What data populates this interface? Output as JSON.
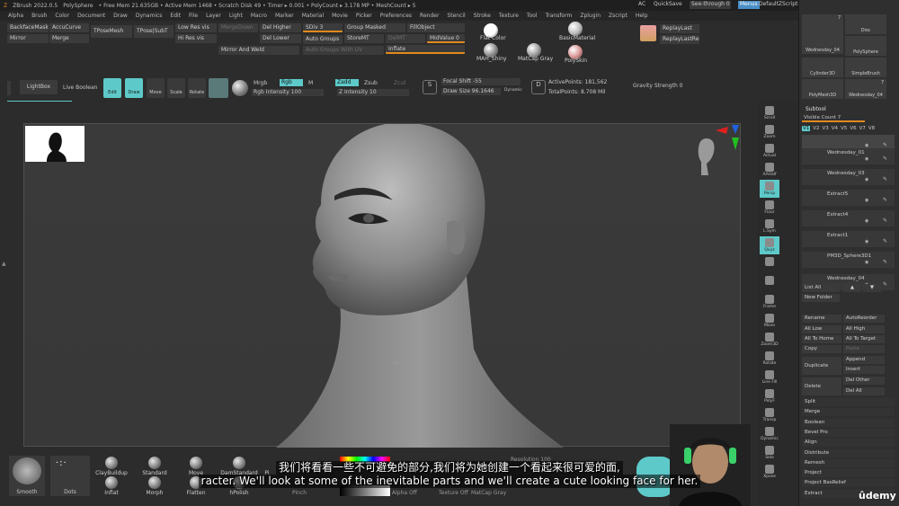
{
  "titlebar": {
    "app": "ZBrush 2022.0.5",
    "items": [
      "PolySphere",
      "• Free Mem 21.635GB • Active Mem 1468 • Scratch Disk 49 • Timer ▸ 0.001 • PolyCount ▸ 3.178 MP • MeshCount ▸ 5"
    ],
    "ac": "AC",
    "quicksave": "QuickSave",
    "see_through": "See-through 0",
    "menus": "Menus",
    "script": "DefaultZScript"
  },
  "menubar": [
    "Alpha",
    "Brush",
    "Color",
    "Document",
    "Draw",
    "Dynamics",
    "Edit",
    "File",
    "Layer",
    "Light",
    "Macro",
    "Marker",
    "Material",
    "Movie",
    "Picker",
    "Preferences",
    "Render",
    "Stencil",
    "Stroke",
    "Texture",
    "Tool",
    "Transform",
    "Zplugin",
    "Zscript",
    "Help"
  ],
  "shelf": {
    "backface_mask": "BackfaceMask",
    "accucurve": "AccuCurve",
    "mirror": "Mirror",
    "merge": "Merge",
    "tposemesh": "TPoseMesh",
    "tpose_subt": "TPose|SubT",
    "low_res": "Low Res vis",
    "hi_res": "Hi Res vis",
    "merge_down": "MergeDown",
    "mirror_and_weld": "Mirror And Weld",
    "del_higher": "Del Higher",
    "del_lower": "Del Lower",
    "sdiv": "SDiv 3",
    "group_masked": "Group Masked",
    "fill_object": "FillObject",
    "auto_groups": "Auto Groups",
    "store_mt": "StoreMT",
    "del_mt": "DelMT",
    "mid_value": "MidValue 0",
    "auto_groups_uv": "Auto Groups With UV",
    "inflate": "Inflate",
    "replay_last": "ReplayLast",
    "replay_last_rel": "ReplayLastRel"
  },
  "materials": [
    {
      "label": "Flat Color",
      "color": "#ffffff"
    },
    {
      "label": "BasicMaterial",
      "color": "#b8b8b8"
    },
    {
      "label": "MAH_Shiny",
      "color": "#8a8a8a"
    },
    {
      "label": "MatCap Gray",
      "color": "#9a9a9a"
    },
    {
      "label": "PolySkin",
      "color": "#d89090"
    }
  ],
  "toolbar": {
    "lightbox": "LightBox",
    "live_boolean": "Live Boolean",
    "edit": "Edit",
    "draw": "Draw",
    "move": "Move",
    "scale": "Scale",
    "rotate": "Rotate",
    "mrgb": "Mrgb",
    "rgb": "Rgb",
    "m": "M",
    "rgb_intensity": "Rgb Intensity 100",
    "zadd": "Zadd",
    "zsub": "Zsub",
    "zcut": "Zcut",
    "z_intensity": "Z Intensity 10",
    "focal_shift": "Focal Shift -55",
    "draw_size": "Draw Size 96.1646",
    "dynamic": "Dynamic",
    "active_points": "ActivePoints: 181,562",
    "total_points": "TotalPoints: 8.708 Mil",
    "gravity": "Gravity Strength 0"
  },
  "right_bar": [
    "Scroll",
    "Zoom",
    "Actual",
    "AAHalf",
    "Persp",
    "Floor",
    "L.Sym",
    "Qxyz",
    "",
    "",
    "Frame",
    "Move",
    "Zoom3D",
    "Rotate",
    "Line Fill",
    "PolyF",
    "Transp",
    "Dynamic",
    "Solo",
    "Xpose"
  ],
  "panel": {
    "thumbs": [
      "Wednesday_04",
      "Disc",
      "Cylinder3D",
      "PolySphere",
      "SimpleBrush",
      "PolyMesh3D",
      "Wednesday_04"
    ],
    "thumb_counts": [
      "7",
      "7"
    ],
    "subtool_title": "Subtool",
    "visible_count": "Visible Count 7",
    "versions": [
      "V1",
      "V2",
      "V3",
      "V4",
      "V5",
      "V6",
      "V7",
      "V8"
    ],
    "subtools": [
      "",
      "Wednesday_01",
      "Wednesday_03",
      "Extract5",
      "Extract4",
      "Extract1",
      "PM3D_Sphere3D1",
      "Wednesday_04"
    ],
    "list_all": "List All",
    "new_folder": "New Folder",
    "rename": "Rename",
    "auto_reorder": "AutoReorder",
    "all_low": "All Low",
    "all_high": "All High",
    "all_to_home": "All To Home",
    "all_to_target": "All To Target",
    "copy": "Copy",
    "paste": "Paste",
    "duplicate": "Duplicate",
    "append": "Append",
    "insert": "Insert",
    "delete": "Delete",
    "del_other": "Del Other",
    "del_all": "Del All",
    "sections": [
      "Split",
      "Merge",
      "Boolean",
      "Bevel Pro",
      "Align",
      "Distribute",
      "Remesh",
      "Project",
      "Project BasRelief",
      "Extract"
    ]
  },
  "brushes": [
    {
      "label": "Smooth"
    },
    {
      "label": "Dots"
    },
    {
      "label": "ClayBuildup"
    },
    {
      "label": "Inflat"
    },
    {
      "label": "Standard"
    },
    {
      "label": "Morph"
    },
    {
      "label": "Move"
    },
    {
      "label": "Flatten"
    },
    {
      "label": "DamStandard"
    },
    {
      "label": "hPolish"
    },
    {
      "label": "Pi"
    }
  ],
  "bottom_extra": {
    "resolution": "Resolution 100",
    "alpha_off": "Alpha Off",
    "texture_off": "Texture Off",
    "matcap": "MatCap Gray",
    "pinch": "Pinch"
  },
  "subtitles": {
    "chinese": "我们将看看一些不可避免的部分,我们将为她创建一个看起来很可爱的面,",
    "english": "racter. We'll look at some of the inevitable parts and we'll create a cute looking face for her."
  },
  "watermark": "ûdemy"
}
